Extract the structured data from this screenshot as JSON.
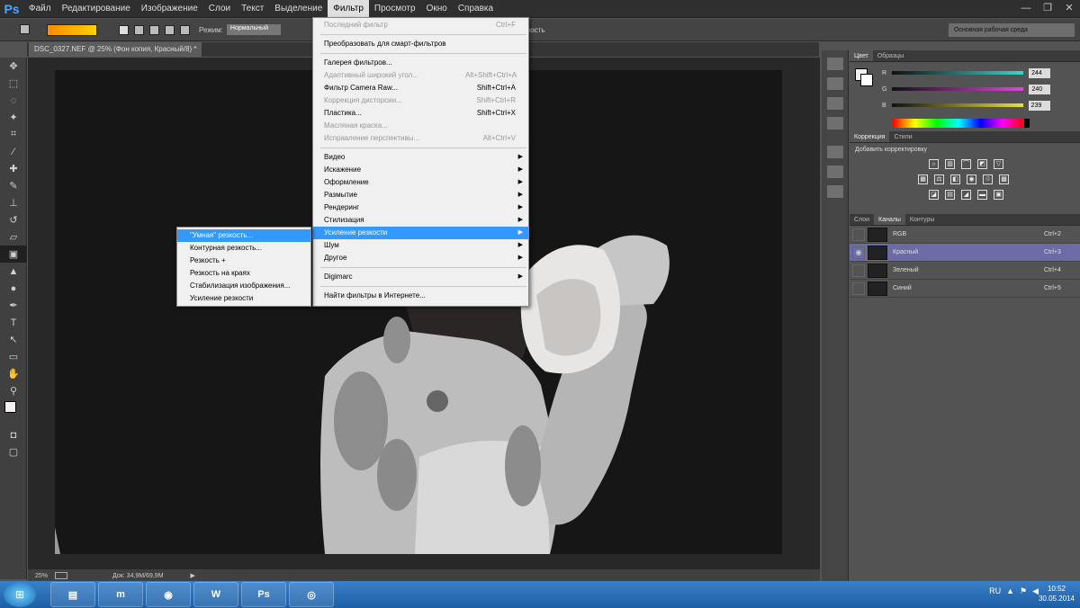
{
  "app": {
    "logo": "Ps"
  },
  "menubar": {
    "items": [
      "Файл",
      "Редактирование",
      "Изображение",
      "Слои",
      "Текст",
      "Выделение",
      "Фильтр",
      "Просмотр",
      "Окно",
      "Справка"
    ],
    "active": "Фильтр"
  },
  "window_controls": [
    "—",
    "❐",
    "✕"
  ],
  "options": {
    "mode_label": "Режим:",
    "mode_value": "Нормальный",
    "opacity_label": "рачность",
    "workspace": "Основная рабочая среда"
  },
  "document": {
    "tab": "DSC_0327.NEF @ 25% (Фон копия, Красный/8) *"
  },
  "status": {
    "zoom": "25%",
    "doc": "Док: 34,9M/69,9M"
  },
  "color_panel": {
    "tabs": [
      "Цвет",
      "Образцы"
    ],
    "sliders": [
      {
        "label": "R",
        "value": "244",
        "gradient": "#3ed3c9"
      },
      {
        "label": "G",
        "value": "240",
        "gradient": "#e046d9"
      },
      {
        "label": "B",
        "value": "239",
        "gradient": "#e9e23a"
      }
    ]
  },
  "adjustments": {
    "tabs": [
      "Коррекция",
      "Стили"
    ],
    "title": "Добавить корректировку"
  },
  "layers": {
    "tabs": [
      "Слои",
      "Каналы",
      "Контуры"
    ],
    "channels": [
      {
        "name": "RGB",
        "key": "Ctrl+2"
      },
      {
        "name": "Красный",
        "key": "Ctrl+3",
        "selected": true
      },
      {
        "name": "Зеленый",
        "key": "Ctrl+4"
      },
      {
        "name": "Синий",
        "key": "Ctrl+5"
      }
    ]
  },
  "filter_menu": {
    "groups": [
      [
        {
          "label": "Последний фильтр",
          "key": "Ctrl+F",
          "disabled": true
        }
      ],
      [
        {
          "label": "Преобразовать для смарт-фильтров",
          "key": ""
        }
      ],
      [
        {
          "label": "Галерея фильтров...",
          "key": ""
        },
        {
          "label": "Адаптивный широкий угол...",
          "key": "Alt+Shift+Ctrl+A",
          "disabled": true
        },
        {
          "label": "Фильтр Camera Raw...",
          "key": "Shift+Ctrl+A"
        },
        {
          "label": "Коррекция дисторсии...",
          "key": "Shift+Ctrl+R",
          "disabled": true
        },
        {
          "label": "Пластика...",
          "key": "Shift+Ctrl+X"
        },
        {
          "label": "Масляная краска...",
          "key": "",
          "disabled": true
        },
        {
          "label": "Исправление перспективы...",
          "key": "Alt+Ctrl+V",
          "disabled": true
        }
      ],
      [
        {
          "label": "Видео",
          "sub": true
        },
        {
          "label": "Искажение",
          "sub": true
        },
        {
          "label": "Оформление",
          "sub": true
        },
        {
          "label": "Размытие",
          "sub": true
        },
        {
          "label": "Рендеринг",
          "sub": true
        },
        {
          "label": "Стилизация",
          "sub": true
        },
        {
          "label": "Усиление резкости",
          "sub": true,
          "highlight": true
        },
        {
          "label": "Шум",
          "sub": true
        },
        {
          "label": "Другое",
          "sub": true
        }
      ],
      [
        {
          "label": "Digimarc",
          "sub": true
        }
      ],
      [
        {
          "label": "Найти фильтры в Интернете...",
          "key": ""
        }
      ]
    ]
  },
  "sharpen_submenu": {
    "items": [
      {
        "label": "\"Умная\" резкость...",
        "highlight": true
      },
      {
        "label": "Контурная резкость..."
      },
      {
        "label": "Резкость +"
      },
      {
        "label": "Резкость на краях"
      },
      {
        "label": "Стабилизация изображения..."
      },
      {
        "label": "Усиление резкости"
      }
    ]
  },
  "taskbar": {
    "apps": [
      {
        "name": "explorer",
        "glyph": "▤"
      },
      {
        "name": "maxthon",
        "glyph": "m"
      },
      {
        "name": "chrome",
        "glyph": "◉"
      },
      {
        "name": "word",
        "glyph": "W"
      },
      {
        "name": "photoshop",
        "glyph": "Ps"
      },
      {
        "name": "viewer",
        "glyph": "◎"
      }
    ],
    "lang": "RU",
    "time": "10:52",
    "date": "30.05.2014"
  }
}
